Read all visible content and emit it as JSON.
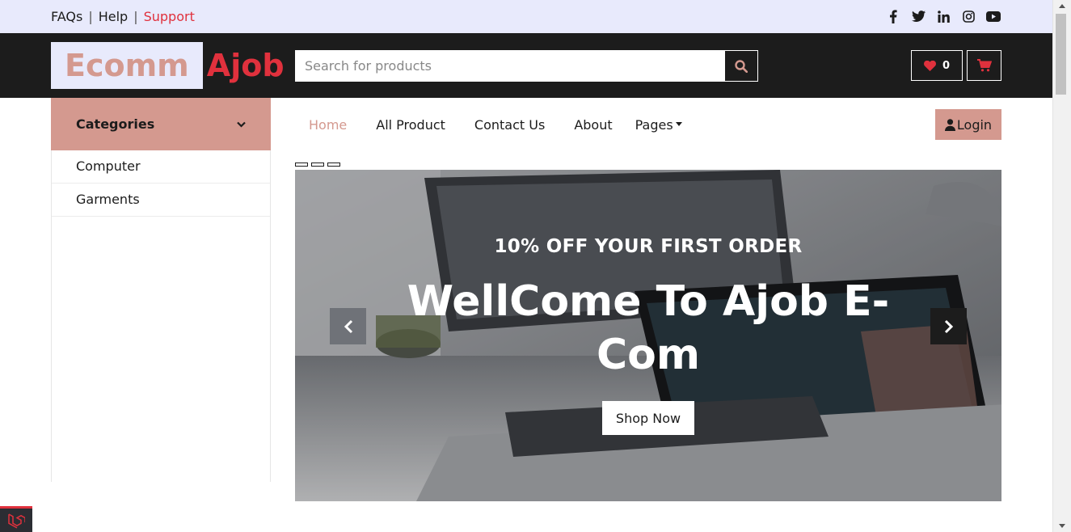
{
  "topbar": {
    "links": [
      {
        "label": "FAQs"
      },
      {
        "label": "Help"
      },
      {
        "label": "Support"
      }
    ],
    "separator": "|",
    "social_icons": [
      "facebook-icon",
      "twitter-icon",
      "linkedin-icon",
      "instagram-icon",
      "youtube-icon"
    ]
  },
  "header": {
    "logo_part1": "Ecomm",
    "logo_part2": "Ajob",
    "search_placeholder": "Search for products",
    "wishlist_count": "0"
  },
  "sidebar": {
    "title": "Categories",
    "items": [
      {
        "label": "Computer"
      },
      {
        "label": "Garments"
      }
    ]
  },
  "nav": {
    "items": [
      {
        "label": "Home",
        "active": true
      },
      {
        "label": "All Product"
      },
      {
        "label": "Contact Us"
      },
      {
        "label": "About"
      },
      {
        "label": "Pages"
      }
    ],
    "login_label": "Login"
  },
  "carousel": {
    "subtitle": "10% OFF YOUR FIRST ORDER",
    "title": "WellCome To Ajob E-Com",
    "button_label": "Shop Now"
  },
  "colors": {
    "accent_pink": "#d4998f",
    "accent_red": "#e0313d",
    "dark": "#1c1c1c",
    "topbar_bg": "#e8eafc"
  }
}
